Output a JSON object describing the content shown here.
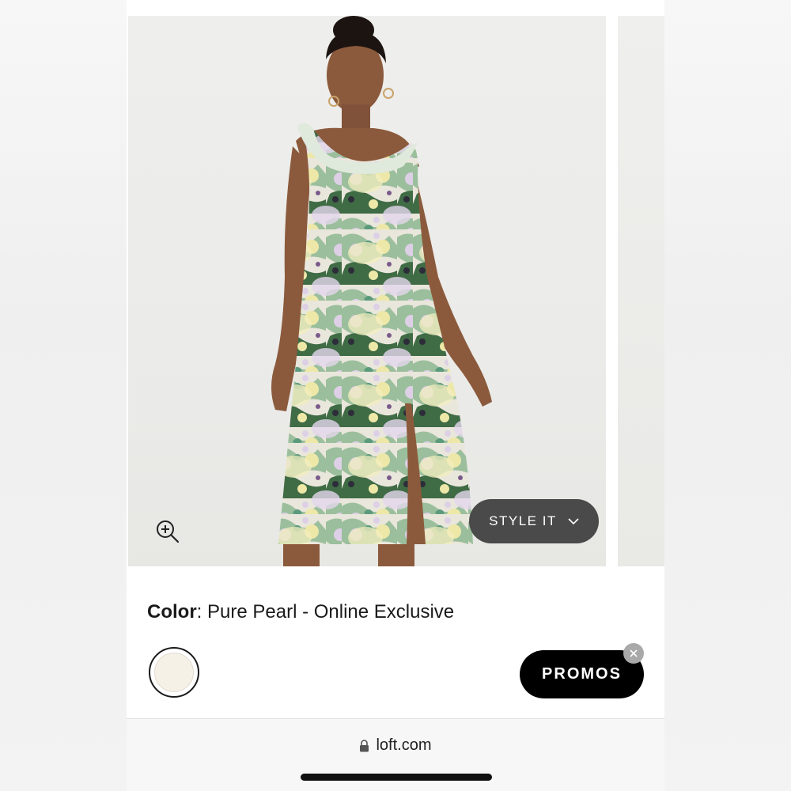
{
  "product": {
    "color_key": "Color",
    "color_value": ": Pure Pearl - Online Exclusive",
    "swatch_color": "#f6f1e6"
  },
  "gallery": {
    "style_it_label": "STYLE IT",
    "zoom_icon": "zoom-in-icon",
    "chevron_icon": "chevron-down-icon"
  },
  "promos": {
    "label": "PROMOS",
    "close_icon": "close-icon"
  },
  "browser": {
    "url": "loft.com",
    "lock_icon": "lock-icon"
  },
  "colors": {
    "style_it_bg": "#4a4a4a",
    "promos_bg": "#000000",
    "dress_green": "#3f6b45",
    "dress_yellow": "#eee8a8",
    "dress_lilac": "#ddd0e6"
  }
}
